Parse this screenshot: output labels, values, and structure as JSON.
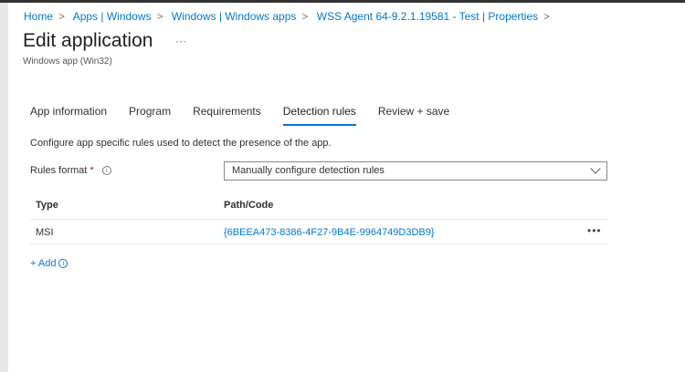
{
  "breadcrumb": [
    "Home",
    "Apps | Windows",
    "Windows | Windows apps",
    "WSS Agent 64-9.2.1.19581 - Test | Properties"
  ],
  "title": "Edit application",
  "more": "···",
  "subtitle": "Windows app (Win32)",
  "tabs": [
    "App information",
    "Program",
    "Requirements",
    "Detection rules",
    "Review + save"
  ],
  "active_tab": "Detection rules",
  "description": "Configure app specific rules used to detect the presence of the app.",
  "rules_format": {
    "label": "Rules format",
    "required": "*",
    "info": "i",
    "value": "Manually configure detection rules"
  },
  "table": {
    "headers": [
      "Type",
      "Path/Code"
    ],
    "rows": [
      {
        "type": "MSI",
        "code": "{6BEEA473-8386-4F27-9B4E-9964749D3DB9}",
        "menu": "•••"
      }
    ]
  },
  "add": {
    "label": "+ Add",
    "info": "i"
  }
}
